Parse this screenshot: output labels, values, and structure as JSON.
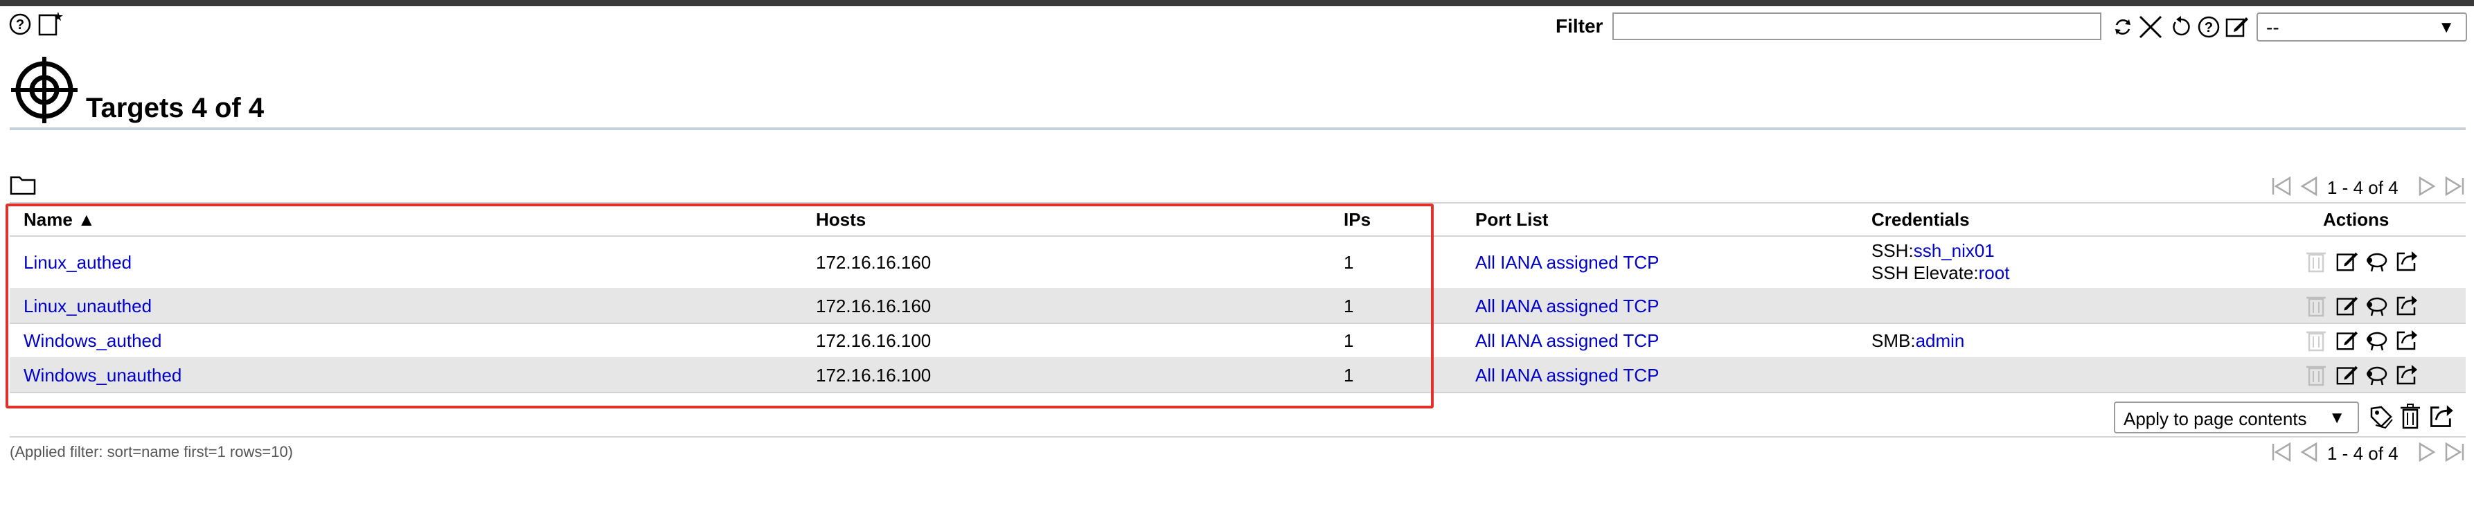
{
  "toolbar": {
    "help_icon": "help-icon",
    "new_icon": "new-target-icon"
  },
  "filter": {
    "label": "Filter",
    "value": "",
    "select_value": "--",
    "icons": [
      "refresh-icon",
      "clear-icon",
      "reset-icon",
      "help-icon",
      "edit-icon"
    ]
  },
  "page": {
    "title": "Targets 4 of 4",
    "pager_top": "1 - 4 of 4",
    "pager_bottom": "1 - 4 of 4"
  },
  "table": {
    "columns": {
      "name": "Name ▲",
      "hosts": "Hosts",
      "ips": "IPs",
      "port_list": "Port List",
      "credentials": "Credentials",
      "actions": "Actions"
    },
    "rows": [
      {
        "name": "Linux_authed",
        "hosts": "172.16.16.160",
        "ips": "1",
        "port_list": "All IANA assigned TCP",
        "cred1_type": "SSH:",
        "cred1_value": "ssh_nix01",
        "cred2_type": "SSH Elevate:",
        "cred2_value": "root"
      },
      {
        "name": "Linux_unauthed",
        "hosts": "172.16.16.160",
        "ips": "1",
        "port_list": "All IANA assigned TCP",
        "cred1_type": "",
        "cred1_value": "",
        "cred2_type": "",
        "cred2_value": ""
      },
      {
        "name": "Windows_authed",
        "hosts": "172.16.16.100",
        "ips": "1",
        "port_list": "All IANA assigned TCP",
        "cred1_type": "SMB:",
        "cred1_value": "admin",
        "cred2_type": "",
        "cred2_value": ""
      },
      {
        "name": "Windows_unauthed",
        "hosts": "172.16.16.100",
        "ips": "1",
        "port_list": "All IANA assigned TCP",
        "cred1_type": "",
        "cred1_value": "",
        "cred2_type": "",
        "cred2_value": ""
      }
    ]
  },
  "bulk": {
    "apply_select": "Apply to page contents"
  },
  "footer": {
    "applied_filter": "(Applied filter: sort=name first=1 rows=10)"
  },
  "colors": {
    "link": "#0000cc",
    "highlight": "#e0312a",
    "row_alt": "#e6e6e6"
  }
}
